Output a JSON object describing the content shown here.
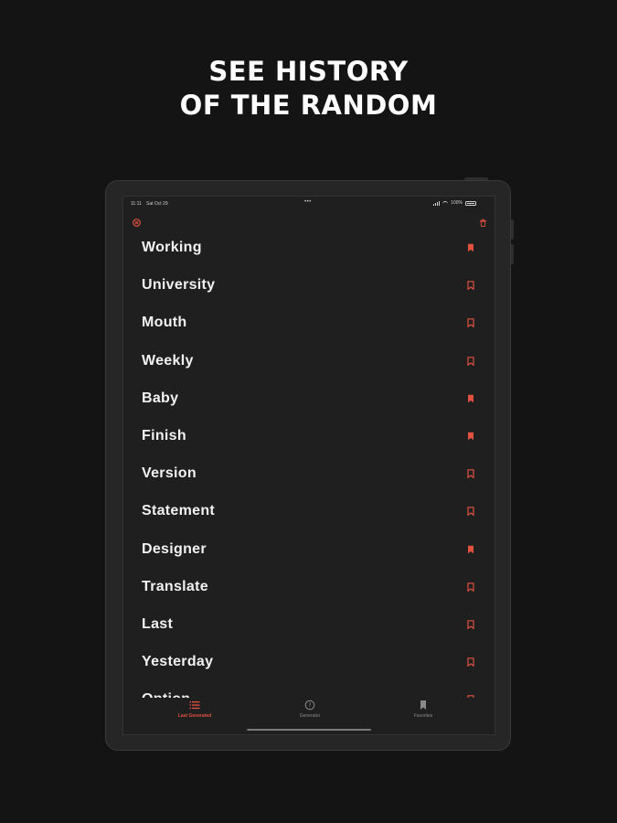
{
  "headline": [
    "SEE HISTORY",
    "OF THE RANDOM"
  ],
  "status_bar": {
    "time": "11:11",
    "date": "Sat Oct 29",
    "battery": "100%"
  },
  "top_actions": {
    "clear_icon": "x-circle-icon",
    "delete_icon": "trash-icon"
  },
  "colors": {
    "accent": "#e0513f",
    "background": "#141414",
    "screen": "#1f1f1f",
    "text": "#f2f2f2"
  },
  "history": [
    {
      "word": "Working",
      "favorite": true
    },
    {
      "word": "University",
      "favorite": false
    },
    {
      "word": "Mouth",
      "favorite": false
    },
    {
      "word": "Weekly",
      "favorite": false
    },
    {
      "word": "Baby",
      "favorite": true
    },
    {
      "word": "Finish",
      "favorite": true
    },
    {
      "word": "Version",
      "favorite": false
    },
    {
      "word": "Statement",
      "favorite": false
    },
    {
      "word": "Designer",
      "favorite": true
    },
    {
      "word": "Translate",
      "favorite": false
    },
    {
      "word": "Last",
      "favorite": false
    },
    {
      "word": "Yesterday",
      "favorite": false
    },
    {
      "word": "Option",
      "favorite": false
    }
  ],
  "tabs": [
    {
      "label": "Last Generated",
      "icon": "list-icon",
      "active": true
    },
    {
      "label": "Generator",
      "icon": "dice-icon",
      "active": false
    },
    {
      "label": "Favorites",
      "icon": "bookmark-icon",
      "active": false
    }
  ]
}
